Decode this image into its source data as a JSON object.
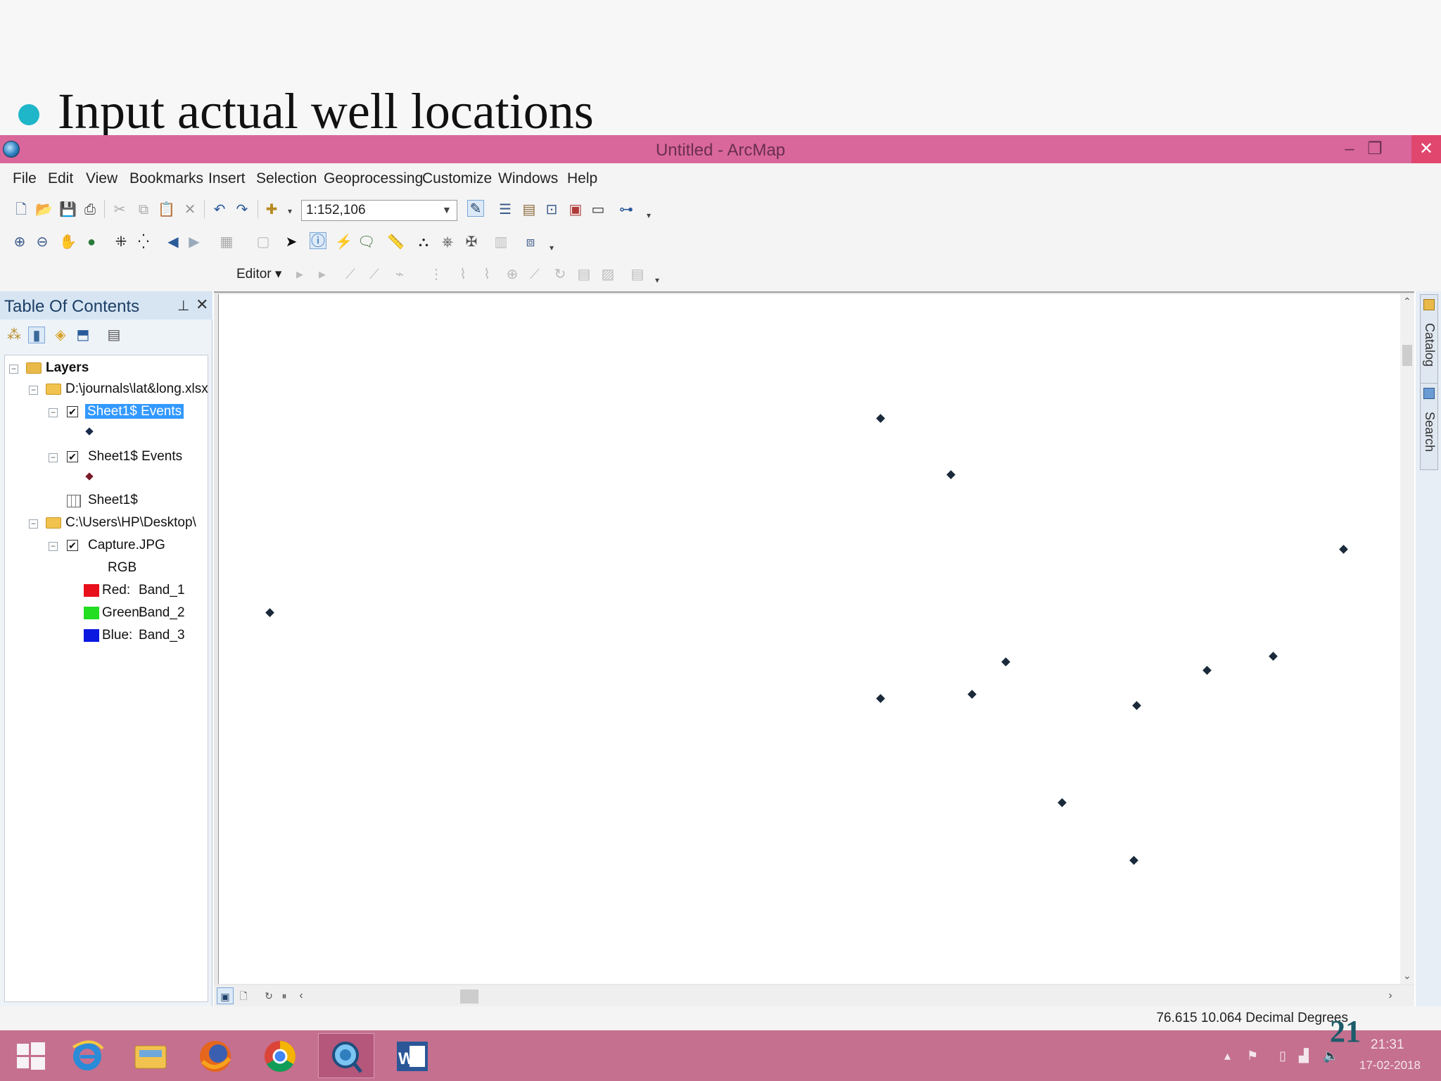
{
  "slide": {
    "title": "Input actual well locations",
    "number": "21",
    "bullet_color": "#1fb6c9"
  },
  "window": {
    "title": "Untitled - ArcMap",
    "title_bar_color": "#d9679b",
    "controls": {
      "minimize": "‒",
      "restore": "❐",
      "close": "✕"
    }
  },
  "menubar": {
    "items": [
      "File",
      "Edit",
      "View",
      "Bookmarks",
      "Insert",
      "Selection",
      "Geoprocessing",
      "Customize",
      "Windows",
      "Help"
    ]
  },
  "toolbar": {
    "scale": "1:152,106",
    "editor_label": "Editor ▾"
  },
  "toc": {
    "title": "Table Of Contents",
    "pin": "⊥",
    "close": "✕",
    "tree": {
      "layers_label": "Layers",
      "source1_label": "D:\\journals\\lat&long.xlsx",
      "event_layer_1": "Sheet1$ Events",
      "event_layer_2": "Sheet1$ Events",
      "table_label": "Sheet1$",
      "source2_label": "C:\\Users\\HP\\Desktop\\",
      "raster_label": "Capture.JPG",
      "rgb_label": "RGB",
      "bands": [
        {
          "channel": "Red:",
          "band": "Band_1",
          "color": "#e8101a"
        },
        {
          "channel": "Green:",
          "band": "Band_2",
          "color": "#22dd22"
        },
        {
          "channel": "Blue:",
          "band": "Band_3",
          "color": "#0a18e0"
        }
      ],
      "symbol_color_1": "#1a2a4a",
      "symbol_color_2": "#7a1a2a"
    }
  },
  "map": {
    "point_color": "#1a2a3a",
    "well_points_count_visible": 14
  },
  "side_dock": {
    "catalog_label": "Catalog",
    "search_label": "Search"
  },
  "statusbar": {
    "coordinates": "76.615  10.064 Decimal Degrees"
  },
  "taskbar": {
    "time": "21:31",
    "date": "17-02-2018",
    "apps": [
      "windows-start",
      "internet-explorer",
      "file-explorer",
      "firefox",
      "chrome",
      "arcmap",
      "word"
    ],
    "color": "#c5708f"
  }
}
